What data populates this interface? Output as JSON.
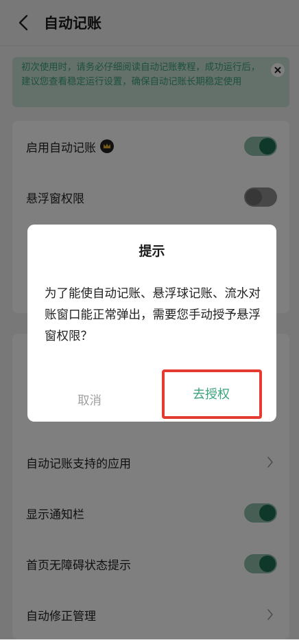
{
  "header": {
    "title": "自动记账"
  },
  "notice": {
    "text": "初次使用时，请务必仔细阅读自动记账教程，成功运行后，建议您查看稳定运行设置，确保自动记账长期稳定使用"
  },
  "settings": {
    "enable_auto": {
      "label": "启用自动记账",
      "enabled": true
    },
    "float_permission": {
      "label": "悬浮窗权限",
      "enabled": false
    },
    "supported_apps": {
      "label": "自动记账支持的应用"
    },
    "show_notification": {
      "label": "显示通知栏",
      "enabled": true
    },
    "home_accessibility": {
      "label": "首页无障碍状态提示",
      "enabled": true
    },
    "auto_correct": {
      "label": "自动修正管理"
    }
  },
  "dialog": {
    "title": "提示",
    "message": "为了能使自动记账、悬浮球记账、流水对账窗口能正常弹出，需要您手动授予悬浮窗权限？",
    "cancel_label": "取消",
    "confirm_label": "去授权"
  },
  "colors": {
    "accent": "#3aa37c",
    "toggle_on": "#1e6f55",
    "highlight": "#e53a2f"
  }
}
